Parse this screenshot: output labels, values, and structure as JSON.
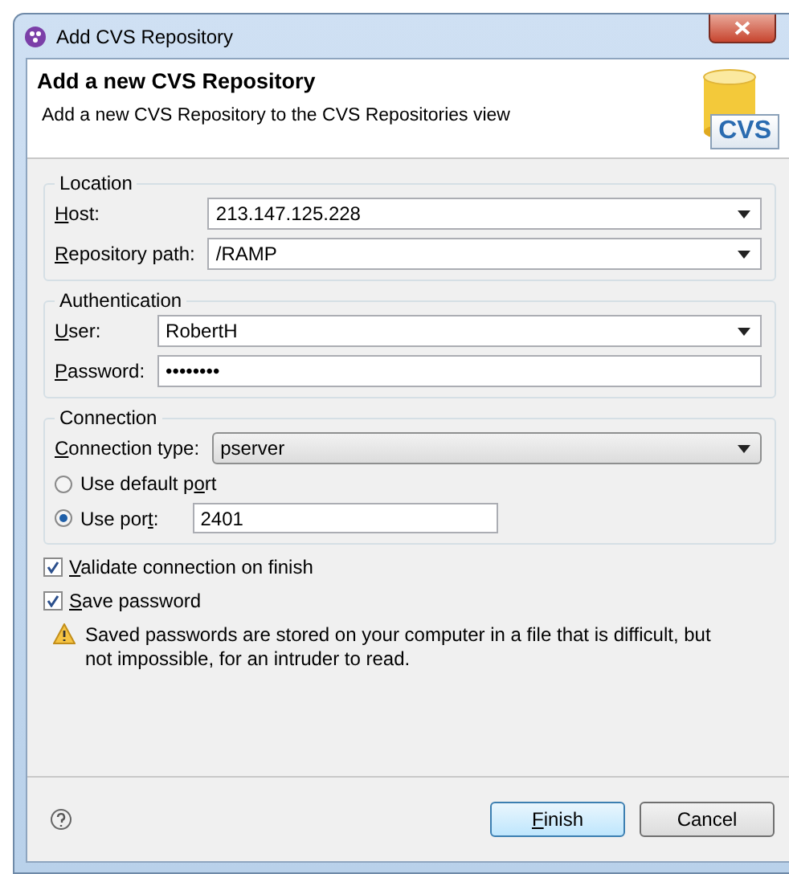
{
  "window": {
    "title": "Add CVS Repository"
  },
  "header": {
    "title": "Add a new CVS Repository",
    "description": "Add a new CVS Repository to the CVS Repositories view",
    "logo_text": "CVS"
  },
  "location": {
    "title": "Location",
    "fields": [
      {
        "label": {
          "key": "H",
          "after": "ost:"
        },
        "value": "213.147.125.228",
        "kind": "combo"
      },
      {
        "label": {
          "key": "R",
          "after": "epository path:"
        },
        "value": "/RAMP",
        "kind": "combo"
      }
    ]
  },
  "authentication": {
    "title": "Authentication",
    "fields": [
      {
        "label": {
          "key": "U",
          "after": "ser:"
        },
        "value": "RobertH",
        "kind": "combo"
      },
      {
        "label": {
          "key": "P",
          "after": "assword:"
        },
        "value": "••••••••",
        "kind": "text"
      }
    ]
  },
  "connection": {
    "title": "Connection",
    "type_label": {
      "key": "C",
      "after": "onnection type:"
    },
    "type_value": "pserver",
    "ports": [
      {
        "label": {
          "before": "Use default p",
          "key": "o",
          "after": "rt"
        },
        "selected": false
      },
      {
        "label": {
          "before": "Use por",
          "key": "t",
          "after": ":"
        },
        "selected": true,
        "value": "2401"
      }
    ]
  },
  "options": [
    {
      "label": {
        "key": "V",
        "after": "alidate connection on finish"
      },
      "checked": true
    },
    {
      "label": {
        "key": "S",
        "after": "ave password"
      },
      "checked": true
    }
  ],
  "warning": "Saved passwords are stored on your computer in a file that is difficult, but not impossible, for an intruder to read.",
  "buttons": [
    {
      "label": {
        "key": "F",
        "after": "inish"
      },
      "default": true
    },
    {
      "label": {
        "after": "Cancel"
      },
      "default": false
    }
  ]
}
